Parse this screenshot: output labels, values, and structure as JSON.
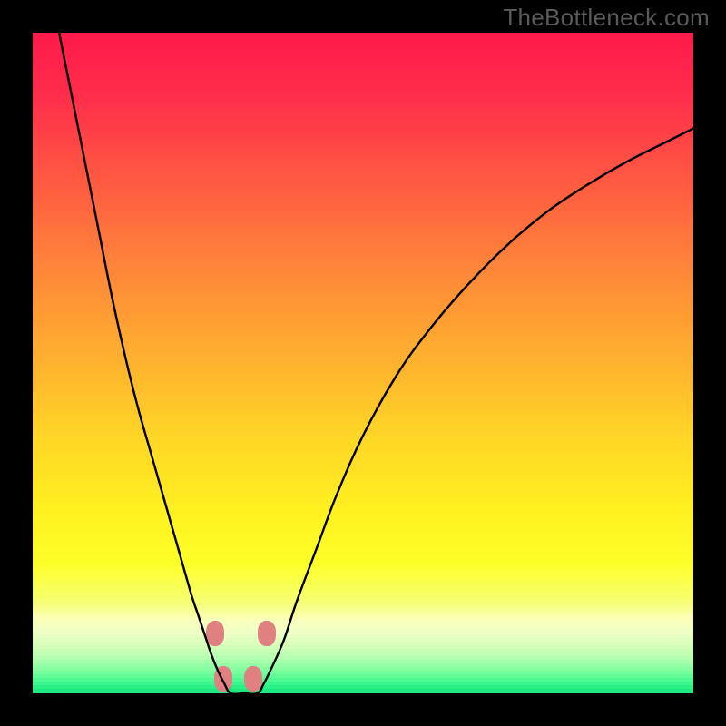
{
  "watermark_text": "TheBottleneck.com",
  "chart_data": {
    "type": "line",
    "title": "",
    "xlabel": "",
    "ylabel": "",
    "xlim": [
      0,
      100
    ],
    "ylim": [
      0,
      100
    ],
    "series": [
      {
        "name": "left-curve",
        "x": [
          4,
          6,
          8,
          10,
          12,
          14,
          16,
          18,
          20,
          22,
          24,
          25,
          26,
          27,
          28,
          29,
          30
        ],
        "values": [
          100,
          90,
          80,
          70,
          60,
          51,
          43,
          36,
          29,
          22,
          15,
          12,
          9,
          6,
          3.5,
          1.5,
          0
        ]
      },
      {
        "name": "valley-floor",
        "x": [
          30,
          32,
          34
        ],
        "values": [
          0,
          0,
          0
        ]
      },
      {
        "name": "right-curve",
        "x": [
          34,
          35,
          36,
          38,
          40,
          43,
          46,
          50,
          55,
          60,
          66,
          72,
          78,
          84,
          90,
          96,
          100
        ],
        "values": [
          0,
          1.5,
          3.5,
          8,
          14,
          22,
          30,
          39,
          48,
          55,
          62,
          68,
          73,
          77,
          80.5,
          83.5,
          85.5
        ]
      }
    ],
    "markers": [
      {
        "x": 27.6,
        "y": 9.0
      },
      {
        "x": 28.8,
        "y": 2.2
      },
      {
        "x": 33.4,
        "y": 2.2
      },
      {
        "x": 35.5,
        "y": 9.0
      }
    ],
    "background_gradient": {
      "stops": [
        {
          "pos": 0.0,
          "color": "#ff1a4b"
        },
        {
          "pos": 0.1,
          "color": "#ff2f4a"
        },
        {
          "pos": 0.22,
          "color": "#ff5942"
        },
        {
          "pos": 0.35,
          "color": "#ff8439"
        },
        {
          "pos": 0.48,
          "color": "#ffad30"
        },
        {
          "pos": 0.6,
          "color": "#ffd327"
        },
        {
          "pos": 0.72,
          "color": "#fff020"
        },
        {
          "pos": 0.8,
          "color": "#fdff28"
        },
        {
          "pos": 0.86,
          "color": "#f6ff74"
        },
        {
          "pos": 0.885,
          "color": "#fbffb8"
        },
        {
          "pos": 0.905,
          "color": "#f0ffc8"
        },
        {
          "pos": 0.925,
          "color": "#d8ffb8"
        },
        {
          "pos": 0.945,
          "color": "#b4ffb0"
        },
        {
          "pos": 0.965,
          "color": "#7cff9e"
        },
        {
          "pos": 0.985,
          "color": "#34f58a"
        },
        {
          "pos": 1.0,
          "color": "#0ee478"
        }
      ]
    }
  }
}
